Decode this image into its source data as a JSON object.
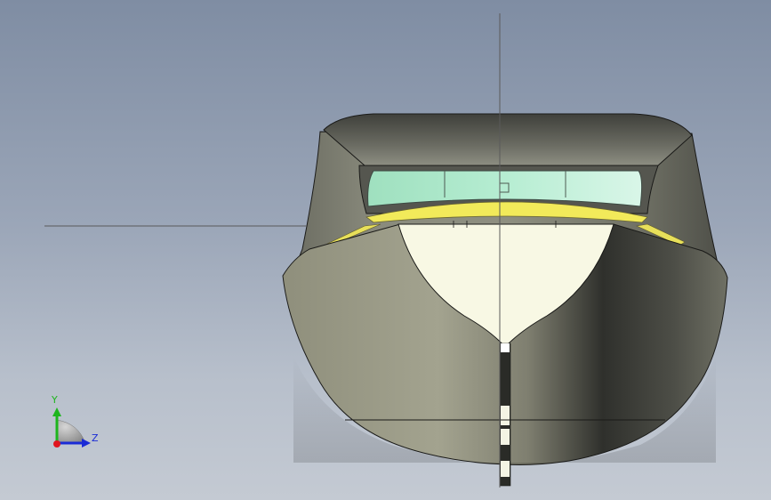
{
  "viewport": {
    "background_top": "#7f8da3",
    "background_bottom": "#c4cad3"
  },
  "triad": {
    "y_label": "Y",
    "z_label": "Z",
    "y_color": "#1db51d",
    "z_color": "#1a2bd6",
    "x_color": "#e0141e"
  },
  "model": {
    "hull_color": "#8d8d7a",
    "deck_color": "#f8f8e4",
    "windshield_color": "#a8e6c4",
    "trim_color": "#f2ea5a",
    "cabin_roof_color": "#5e5f58"
  }
}
